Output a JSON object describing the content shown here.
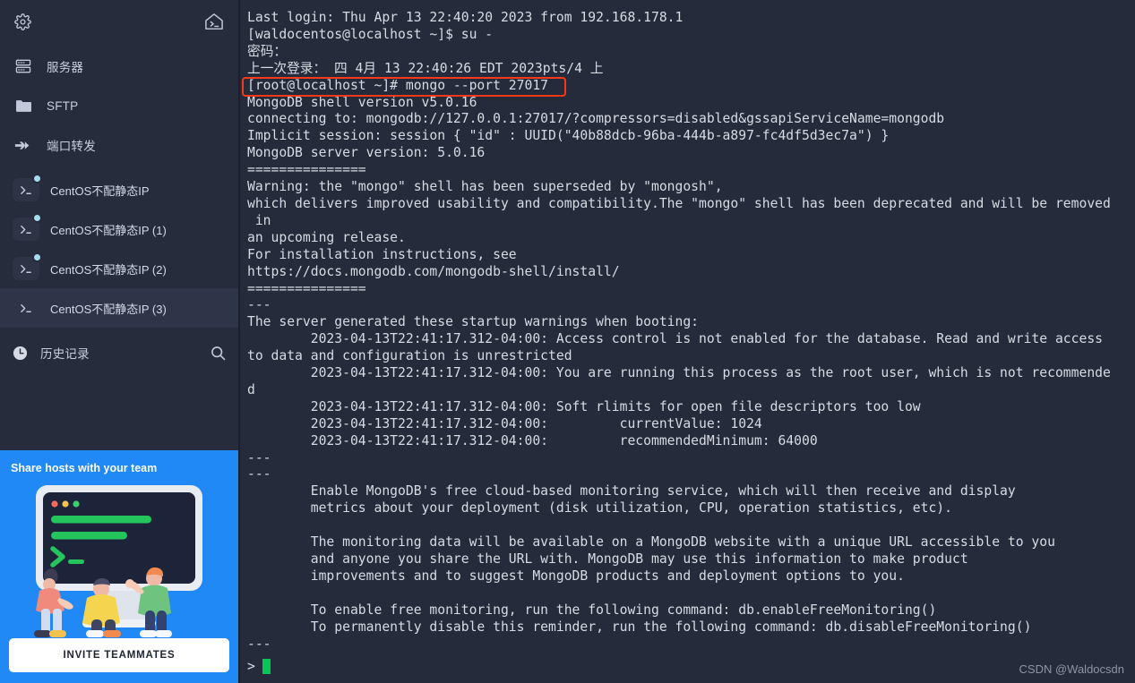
{
  "theme": {
    "sidebar_bg": "#272c3d",
    "terminal_bg": "#252b3a",
    "terminal_fg": "#d7dbe4",
    "accent_blue": "#2089f5",
    "highlight_red": "#f5391a",
    "cursor_green": "#06c755",
    "status_dot": "#a8dced",
    "active_row_bg": "#2f3548"
  },
  "sidebar": {
    "top_bar": {
      "settings_icon": "gear-icon",
      "home_icon": "home-terminal-icon"
    },
    "nav": [
      {
        "icon": "server-rack-icon",
        "label": "服务器"
      },
      {
        "icon": "folder-icon",
        "label": "SFTP"
      },
      {
        "icon": "port-forward-arrow-icon",
        "label": "端口转发"
      }
    ],
    "sessions": [
      {
        "icon": "terminal-prompt-icon",
        "label": "CentOS不配静态IP",
        "connected": true,
        "active": false
      },
      {
        "icon": "terminal-prompt-icon",
        "label": "CentOS不配静态IP (1)",
        "connected": true,
        "active": false
      },
      {
        "icon": "terminal-prompt-icon",
        "label": "CentOS不配静态IP (2)",
        "connected": true,
        "active": false
      },
      {
        "icon": "terminal-prompt-icon",
        "label": "CentOS不配静态IP (3)",
        "connected": false,
        "active": true
      }
    ],
    "history": {
      "icon": "clock-icon",
      "label": "历史记录",
      "search_icon": "search-icon"
    },
    "promo": {
      "title": "Share hosts with your team",
      "button_label": "INVITE TEAMMATES",
      "art": "team-terminal-illustration"
    }
  },
  "terminal": {
    "lines": [
      "Last login: Thu Apr 13 22:40:20 2023 from 192.168.178.1",
      "[waldocentos@localhost ~]$ su -",
      "密码：",
      "上一次登录： 四 4月 13 22:40:26 EDT 2023pts/4 上",
      "[root@localhost ~]# mongo --port 27017",
      "MongoDB shell version v5.0.16",
      "connecting to: mongodb://127.0.0.1:27017/?compressors=disabled&gssapiServiceName=mongodb",
      "Implicit session: session { \"id\" : UUID(\"40b88dcb-96ba-444b-a897-fc4df5d3ec7a\") }",
      "MongoDB server version: 5.0.16",
      "===============",
      "Warning: the \"mongo\" shell has been superseded by \"mongosh\",",
      "which delivers improved usability and compatibility.The \"mongo\" shell has been deprecated and will be removed",
      " in",
      "an upcoming release.",
      "For installation instructions, see",
      "https://docs.mongodb.com/mongodb-shell/install/",
      "===============",
      "---",
      "The server generated these startup warnings when booting:",
      "        2023-04-13T22:41:17.312-04:00: Access control is not enabled for the database. Read and write access",
      "to data and configuration is unrestricted",
      "        2023-04-13T22:41:17.312-04:00: You are running this process as the root user, which is not recommende",
      "d",
      "        2023-04-13T22:41:17.312-04:00: Soft rlimits for open file descriptors too low",
      "        2023-04-13T22:41:17.312-04:00:         currentValue: 1024",
      "        2023-04-13T22:41:17.312-04:00:         recommendedMinimum: 64000",
      "---",
      "---",
      "        Enable MongoDB's free cloud-based monitoring service, which will then receive and display",
      "        metrics about your deployment (disk utilization, CPU, operation statistics, etc).",
      "",
      "        The monitoring data will be available on a MongoDB website with a unique URL accessible to you",
      "        and anyone you share the URL with. MongoDB may use this information to make product",
      "        improvements and to suggest MongoDB products and deployment options to you.",
      "",
      "        To enable free monitoring, run the following command: db.enableFreeMonitoring()",
      "        To permanently disable this reminder, run the following command: db.disableFreeMonitoring()",
      "---"
    ],
    "highlighted_command_line_index": 4,
    "prompt_symbol": ">",
    "cursor_visible": true,
    "watermark": "CSDN @Waldocsdn"
  }
}
